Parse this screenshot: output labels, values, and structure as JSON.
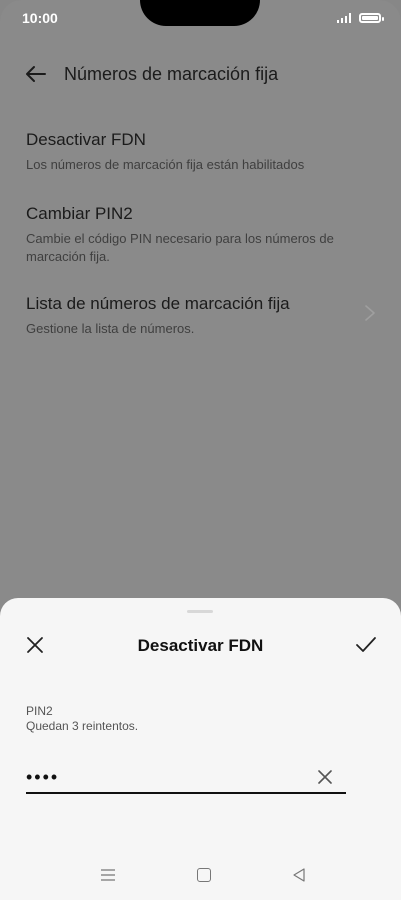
{
  "status": {
    "time": "10:00"
  },
  "header": {
    "title": "Números de marcación fija"
  },
  "items": [
    {
      "title": "Desactivar FDN",
      "subtitle": "Los números de marcación fija están habilitados"
    },
    {
      "title": "Cambiar PIN2",
      "subtitle": "Cambie el código PIN necesario para los números de marcación fija."
    },
    {
      "title": "Lista de números de marcación fija",
      "subtitle": "Gestione la lista de números."
    }
  ],
  "sheet": {
    "title": "Desactivar FDN",
    "field_label": "PIN2",
    "field_hint": "Quedan 3 reintentos.",
    "pin_value": "••••"
  },
  "icons": {
    "back": "back-arrow-icon",
    "chevron": "chevron-right-icon",
    "close": "close-icon",
    "confirm": "check-icon",
    "clear": "clear-icon",
    "nav_menu": "menu-icon",
    "nav_home": "home-icon",
    "nav_back": "back-triangle-icon"
  }
}
